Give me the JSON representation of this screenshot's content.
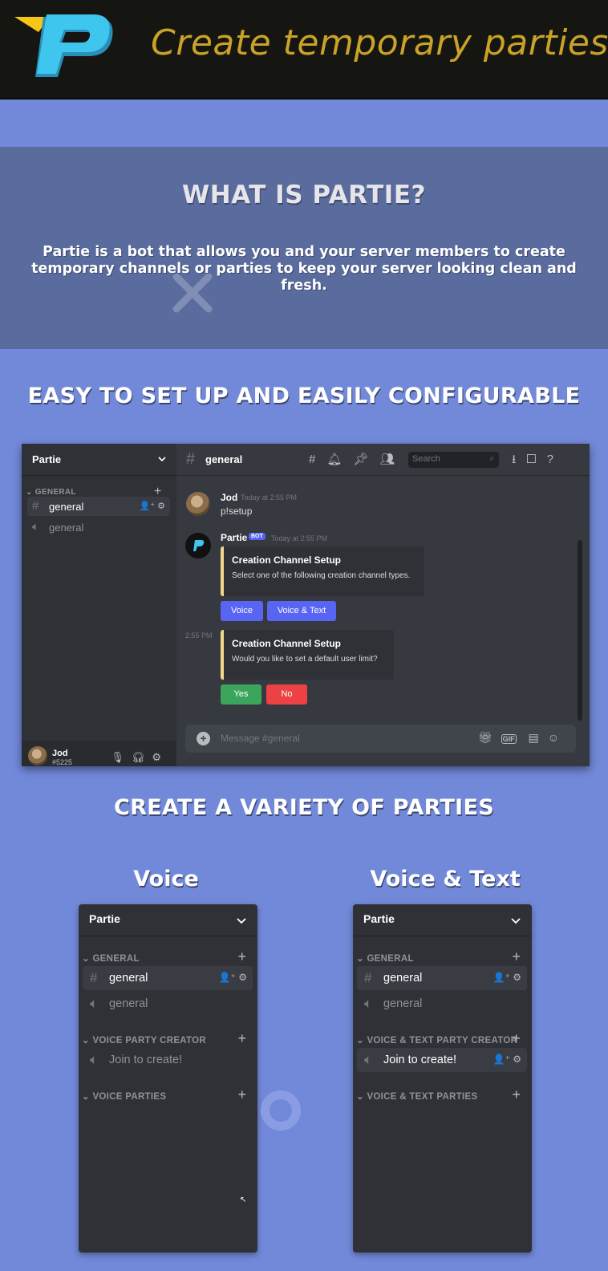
{
  "header": {
    "tagline": "Create temporary parties.",
    "logo_icon": "partie-logo-icon",
    "logo_colors": [
      "#f5c518",
      "#3ec6ef",
      "#2a8fb8"
    ]
  },
  "what_is": {
    "title": "WHAT IS PARTIE?",
    "description": "Partie is a bot that allows you and your server members to create temporary channels or parties to keep your server looking clean and fresh."
  },
  "setup_section": {
    "title": "EASY TO SET UP AND EASILY CONFIGURABLE"
  },
  "discord": {
    "server_name": "Partie",
    "category": "GENERAL",
    "channels": [
      {
        "type": "text",
        "name": "general",
        "selected": true
      },
      {
        "type": "voice",
        "name": "general",
        "selected": false
      }
    ],
    "channel_header": "general",
    "search_placeholder": "Search",
    "user": {
      "name": "Jod",
      "tag": "#5225"
    },
    "messages": [
      {
        "author": "Jod",
        "time": "Today at 2:55 PM",
        "text": "p!setup"
      },
      {
        "author": "Partie",
        "badge": "BOT",
        "time": "Today at 2:55 PM"
      }
    ],
    "embed1": {
      "title": "Creation Channel Setup",
      "description": "Select one of the following creation channel types."
    },
    "embed1_buttons": [
      "Voice",
      "Voice & Text"
    ],
    "followup_time": "2:55 PM",
    "embed2": {
      "title": "Creation Channel Setup",
      "description": "Would you like to set a default user limit?"
    },
    "embed2_buttons": [
      "Yes",
      "No"
    ],
    "input_placeholder": "Message #general",
    "gif_label": "GIF",
    "colors": {
      "blurple": "#5865f2",
      "green": "#3ba55c",
      "red": "#ed4245",
      "embed_border": "#f0d78c"
    }
  },
  "parties_section": {
    "title": "CREATE A VARIETY OF PARTIES"
  },
  "voice_panel": {
    "title": "Voice",
    "server_name": "Partie",
    "cat_general": "GENERAL",
    "ch_text": "general",
    "ch_voice": "general",
    "cat_creator": "VOICE PARTY CREATOR",
    "ch_create": "Join to create!",
    "cat_parties": "VOICE PARTIES"
  },
  "voicetext_panel": {
    "title": "Voice & Text",
    "server_name": "Partie",
    "cat_general": "GENERAL",
    "ch_text": "general",
    "ch_voice": "general",
    "cat_creator": "VOICE & TEXT PARTY CREATOR",
    "ch_create": "Join to create!",
    "cat_parties": "VOICE & TEXT PARTIES"
  }
}
